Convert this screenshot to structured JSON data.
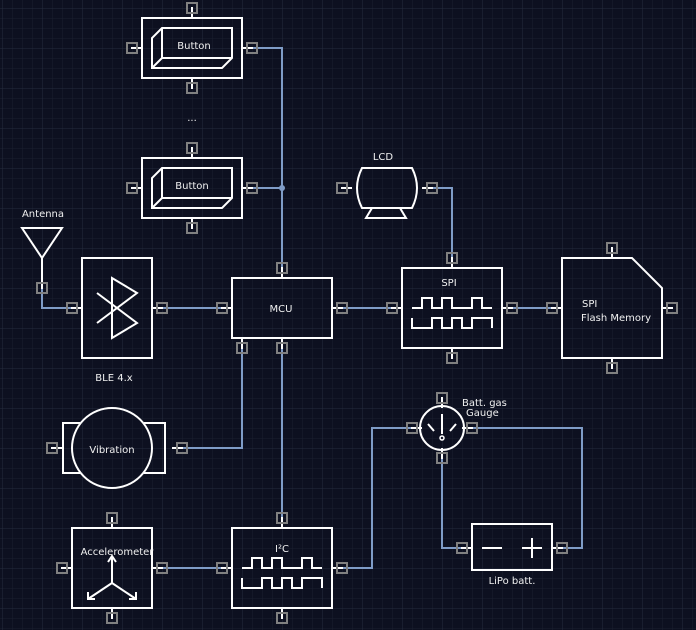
{
  "colors": {
    "background": "#0d1020",
    "wire": "#7f9cc7",
    "shape": "#ffffff",
    "port": "#808080",
    "grid": "#1c2133"
  },
  "labels": {
    "button_1": "Button",
    "ellipsis": "...",
    "button_2": "Button",
    "antenna": "Antenna",
    "lcd": "LCD",
    "mcu": "MCU",
    "spi": "SPI",
    "flash_line1": "SPI",
    "flash_line2": "Flash Memory",
    "ble": "BLE 4.x",
    "vibration": "Vibration",
    "gauge_line1": "Batt. gas",
    "gauge_line2": "Gauge",
    "accelerometer": "Accelerometer",
    "i2c": "I²C",
    "lipo": "LiPo batt."
  }
}
